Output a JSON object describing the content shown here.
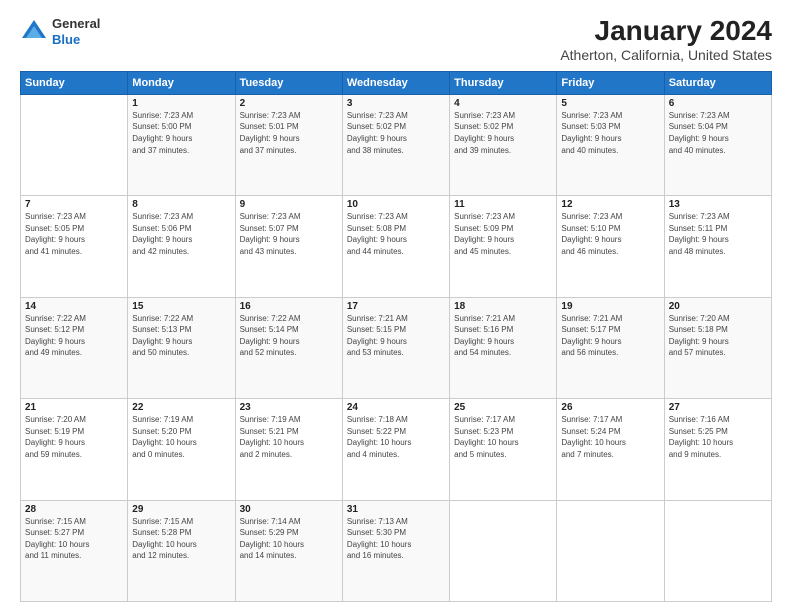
{
  "logo": {
    "general": "General",
    "blue": "Blue"
  },
  "header": {
    "title": "January 2024",
    "subtitle": "Atherton, California, United States"
  },
  "days_of_week": [
    "Sunday",
    "Monday",
    "Tuesday",
    "Wednesday",
    "Thursday",
    "Friday",
    "Saturday"
  ],
  "weeks": [
    [
      {
        "day": "",
        "info": ""
      },
      {
        "day": "1",
        "info": "Sunrise: 7:23 AM\nSunset: 5:00 PM\nDaylight: 9 hours\nand 37 minutes."
      },
      {
        "day": "2",
        "info": "Sunrise: 7:23 AM\nSunset: 5:01 PM\nDaylight: 9 hours\nand 37 minutes."
      },
      {
        "day": "3",
        "info": "Sunrise: 7:23 AM\nSunset: 5:02 PM\nDaylight: 9 hours\nand 38 minutes."
      },
      {
        "day": "4",
        "info": "Sunrise: 7:23 AM\nSunset: 5:02 PM\nDaylight: 9 hours\nand 39 minutes."
      },
      {
        "day": "5",
        "info": "Sunrise: 7:23 AM\nSunset: 5:03 PM\nDaylight: 9 hours\nand 40 minutes."
      },
      {
        "day": "6",
        "info": "Sunrise: 7:23 AM\nSunset: 5:04 PM\nDaylight: 9 hours\nand 40 minutes."
      }
    ],
    [
      {
        "day": "7",
        "info": "Sunrise: 7:23 AM\nSunset: 5:05 PM\nDaylight: 9 hours\nand 41 minutes."
      },
      {
        "day": "8",
        "info": "Sunrise: 7:23 AM\nSunset: 5:06 PM\nDaylight: 9 hours\nand 42 minutes."
      },
      {
        "day": "9",
        "info": "Sunrise: 7:23 AM\nSunset: 5:07 PM\nDaylight: 9 hours\nand 43 minutes."
      },
      {
        "day": "10",
        "info": "Sunrise: 7:23 AM\nSunset: 5:08 PM\nDaylight: 9 hours\nand 44 minutes."
      },
      {
        "day": "11",
        "info": "Sunrise: 7:23 AM\nSunset: 5:09 PM\nDaylight: 9 hours\nand 45 minutes."
      },
      {
        "day": "12",
        "info": "Sunrise: 7:23 AM\nSunset: 5:10 PM\nDaylight: 9 hours\nand 46 minutes."
      },
      {
        "day": "13",
        "info": "Sunrise: 7:23 AM\nSunset: 5:11 PM\nDaylight: 9 hours\nand 48 minutes."
      }
    ],
    [
      {
        "day": "14",
        "info": "Sunrise: 7:22 AM\nSunset: 5:12 PM\nDaylight: 9 hours\nand 49 minutes."
      },
      {
        "day": "15",
        "info": "Sunrise: 7:22 AM\nSunset: 5:13 PM\nDaylight: 9 hours\nand 50 minutes."
      },
      {
        "day": "16",
        "info": "Sunrise: 7:22 AM\nSunset: 5:14 PM\nDaylight: 9 hours\nand 52 minutes."
      },
      {
        "day": "17",
        "info": "Sunrise: 7:21 AM\nSunset: 5:15 PM\nDaylight: 9 hours\nand 53 minutes."
      },
      {
        "day": "18",
        "info": "Sunrise: 7:21 AM\nSunset: 5:16 PM\nDaylight: 9 hours\nand 54 minutes."
      },
      {
        "day": "19",
        "info": "Sunrise: 7:21 AM\nSunset: 5:17 PM\nDaylight: 9 hours\nand 56 minutes."
      },
      {
        "day": "20",
        "info": "Sunrise: 7:20 AM\nSunset: 5:18 PM\nDaylight: 9 hours\nand 57 minutes."
      }
    ],
    [
      {
        "day": "21",
        "info": "Sunrise: 7:20 AM\nSunset: 5:19 PM\nDaylight: 9 hours\nand 59 minutes."
      },
      {
        "day": "22",
        "info": "Sunrise: 7:19 AM\nSunset: 5:20 PM\nDaylight: 10 hours\nand 0 minutes."
      },
      {
        "day": "23",
        "info": "Sunrise: 7:19 AM\nSunset: 5:21 PM\nDaylight: 10 hours\nand 2 minutes."
      },
      {
        "day": "24",
        "info": "Sunrise: 7:18 AM\nSunset: 5:22 PM\nDaylight: 10 hours\nand 4 minutes."
      },
      {
        "day": "25",
        "info": "Sunrise: 7:17 AM\nSunset: 5:23 PM\nDaylight: 10 hours\nand 5 minutes."
      },
      {
        "day": "26",
        "info": "Sunrise: 7:17 AM\nSunset: 5:24 PM\nDaylight: 10 hours\nand 7 minutes."
      },
      {
        "day": "27",
        "info": "Sunrise: 7:16 AM\nSunset: 5:25 PM\nDaylight: 10 hours\nand 9 minutes."
      }
    ],
    [
      {
        "day": "28",
        "info": "Sunrise: 7:15 AM\nSunset: 5:27 PM\nDaylight: 10 hours\nand 11 minutes."
      },
      {
        "day": "29",
        "info": "Sunrise: 7:15 AM\nSunset: 5:28 PM\nDaylight: 10 hours\nand 12 minutes."
      },
      {
        "day": "30",
        "info": "Sunrise: 7:14 AM\nSunset: 5:29 PM\nDaylight: 10 hours\nand 14 minutes."
      },
      {
        "day": "31",
        "info": "Sunrise: 7:13 AM\nSunset: 5:30 PM\nDaylight: 10 hours\nand 16 minutes."
      },
      {
        "day": "",
        "info": ""
      },
      {
        "day": "",
        "info": ""
      },
      {
        "day": "",
        "info": ""
      }
    ]
  ]
}
